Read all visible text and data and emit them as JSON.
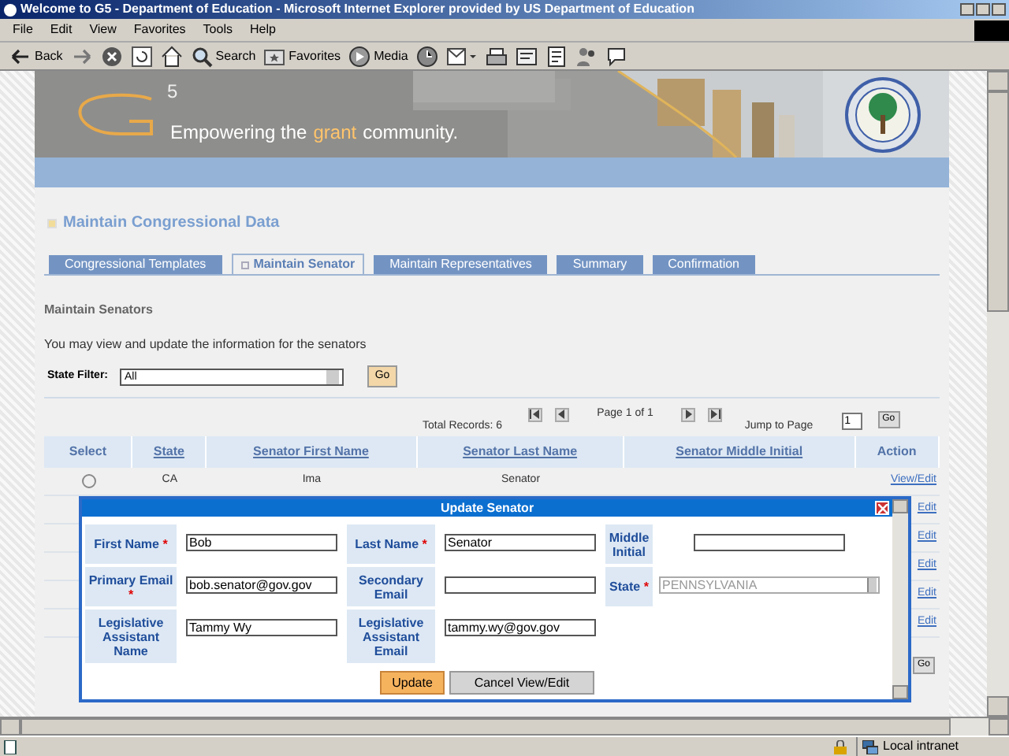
{
  "window": {
    "title": "Welcome to G5 - Department of Education - Microsoft Internet Explorer provided by US Department of Education"
  },
  "menu": [
    "File",
    "Edit",
    "View",
    "Favorites",
    "Tools",
    "Help"
  ],
  "toolbar": [
    {
      "kind": "back",
      "label": "Back"
    },
    {
      "kind": "forward"
    },
    {
      "kind": "stop"
    },
    {
      "kind": "refresh"
    },
    {
      "kind": "home"
    },
    {
      "kind": "search",
      "label": "Search"
    },
    {
      "kind": "favorites",
      "label": "Favorites"
    },
    {
      "kind": "media",
      "label": "Media"
    },
    {
      "kind": "history"
    },
    {
      "kind": "mail"
    },
    {
      "kind": "print"
    },
    {
      "kind": "edit"
    },
    {
      "kind": "discuss"
    },
    {
      "kind": "messenger"
    },
    {
      "kind": "chat"
    }
  ],
  "banner": {
    "logo_sup": "5",
    "tagline": {
      "before": "Empowering the",
      "highlight": "grant",
      "after": "community."
    }
  },
  "page_title": "Maintain Congressional Data",
  "tabs": [
    {
      "label": "Congressional Templates",
      "selected": false
    },
    {
      "label": "Maintain Senator",
      "selected": true
    },
    {
      "label": "Maintain Representatives",
      "selected": false
    },
    {
      "label": "Summary",
      "selected": false
    },
    {
      "label": "Confirmation",
      "selected": false
    }
  ],
  "section_title": "Maintain Senators",
  "intro": "You may view and update the information for the senators",
  "filter": {
    "label": "State Filter:",
    "value": "All",
    "button": "Go"
  },
  "pagination": {
    "total": "Total Records: 6",
    "page": "Page 1 of 1",
    "jump_label": "Jump to Page",
    "jump_value": "1",
    "button": "Go"
  },
  "table": {
    "columns": [
      "Select",
      "State",
      "Senator First Name",
      "Senator Last Name",
      "Senator Middle Initial",
      "Action"
    ],
    "rows": [
      {
        "selected": false,
        "state": "CA",
        "first_name": "Ima",
        "last_name": "Senator",
        "action": "View/Edit"
      },
      {
        "action": "Edit"
      },
      {
        "action": "Edit"
      },
      {
        "action": "Edit"
      },
      {
        "action": "Edit"
      },
      {
        "action": "Edit"
      }
    ],
    "bottom_button": "Go"
  },
  "dialog": {
    "title": "Update Senator",
    "required_mark": "*",
    "rows": [
      [
        {
          "label": "First Name",
          "required": true,
          "kind": "text",
          "value": "Bob"
        },
        {
          "label": "Last Name",
          "required": true,
          "kind": "text",
          "value": "Senator"
        },
        {
          "label": "Middle Initial",
          "required": false,
          "kind": "text"
        }
      ],
      [
        {
          "label": "Primary Email",
          "required": true,
          "kind": "text",
          "value": "bob.senator@gov.gov"
        },
        {
          "label": "Secondary Email",
          "required": false,
          "kind": "text"
        },
        {
          "label": "State",
          "required": true,
          "kind": "select",
          "value": "PENNSYLVANIA"
        }
      ],
      [
        {
          "label": "Legislative Assistant Name",
          "required": false,
          "kind": "text",
          "value": "Tammy Wy"
        },
        {
          "label": "Legislative Assistant Email",
          "required": false,
          "kind": "text",
          "value": "tammy.wy@gov.gov"
        }
      ]
    ],
    "buttons": [
      {
        "label": "Update",
        "kind": "primary"
      },
      {
        "label": "Cancel View/Edit",
        "kind": "secondary"
      }
    ]
  },
  "status_bar": {
    "zone": "Local intranet"
  }
}
